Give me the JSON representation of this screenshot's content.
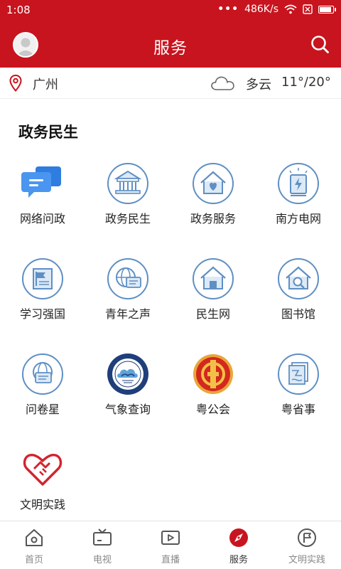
{
  "status_bar": {
    "time": "1:08",
    "network_speed": "486K/s",
    "icons": [
      "more-dots-icon",
      "wifi-icon",
      "sim-icon",
      "battery-icon"
    ]
  },
  "header": {
    "title": "服务",
    "avatar_icon": "user-avatar",
    "search_icon": "search-icon",
    "background_color": "#c8141e"
  },
  "location": {
    "city": "广州",
    "weather": "多云",
    "temperature": "11°/20°",
    "icons": [
      "location-pin-icon",
      "cloud-icon"
    ]
  },
  "section": {
    "title": "政务民生",
    "items": [
      {
        "label": "网络问政",
        "icon": "chat-bubbles-icon"
      },
      {
        "label": "政务民生",
        "icon": "government-building-icon"
      },
      {
        "label": "政务服务",
        "icon": "house-heart-icon"
      },
      {
        "label": "南方电网",
        "icon": "electricity-icon"
      },
      {
        "label": "学习强国",
        "icon": "flag-document-icon"
      },
      {
        "label": "青年之声",
        "icon": "globe-chat-icon"
      },
      {
        "label": "民生网",
        "icon": "house-icon"
      },
      {
        "label": "图书馆",
        "icon": "house-search-icon"
      },
      {
        "label": "问卷星",
        "icon": "globe-survey-icon"
      },
      {
        "label": "气象查询",
        "icon": "weather-bureau-logo"
      },
      {
        "label": "粤公会",
        "icon": "trade-union-logo"
      },
      {
        "label": "粤省事",
        "icon": "document-stack-icon"
      },
      {
        "label": "文明实践",
        "icon": "heart-handshake-icon"
      }
    ]
  },
  "bottom_nav": {
    "active_index": 3,
    "items": [
      {
        "label": "首页",
        "icon": "home-icon"
      },
      {
        "label": "电视",
        "icon": "tv-icon"
      },
      {
        "label": "直播",
        "icon": "live-video-icon"
      },
      {
        "label": "服务",
        "icon": "compass-icon"
      },
      {
        "label": "文明实践",
        "icon": "flag-badge-icon"
      }
    ]
  },
  "colors": {
    "brand_red": "#c8141e",
    "icon_blue": "#5f8fc3",
    "icon_light_blue": "#dce9f7",
    "chat_blue": "#3c8bea"
  }
}
